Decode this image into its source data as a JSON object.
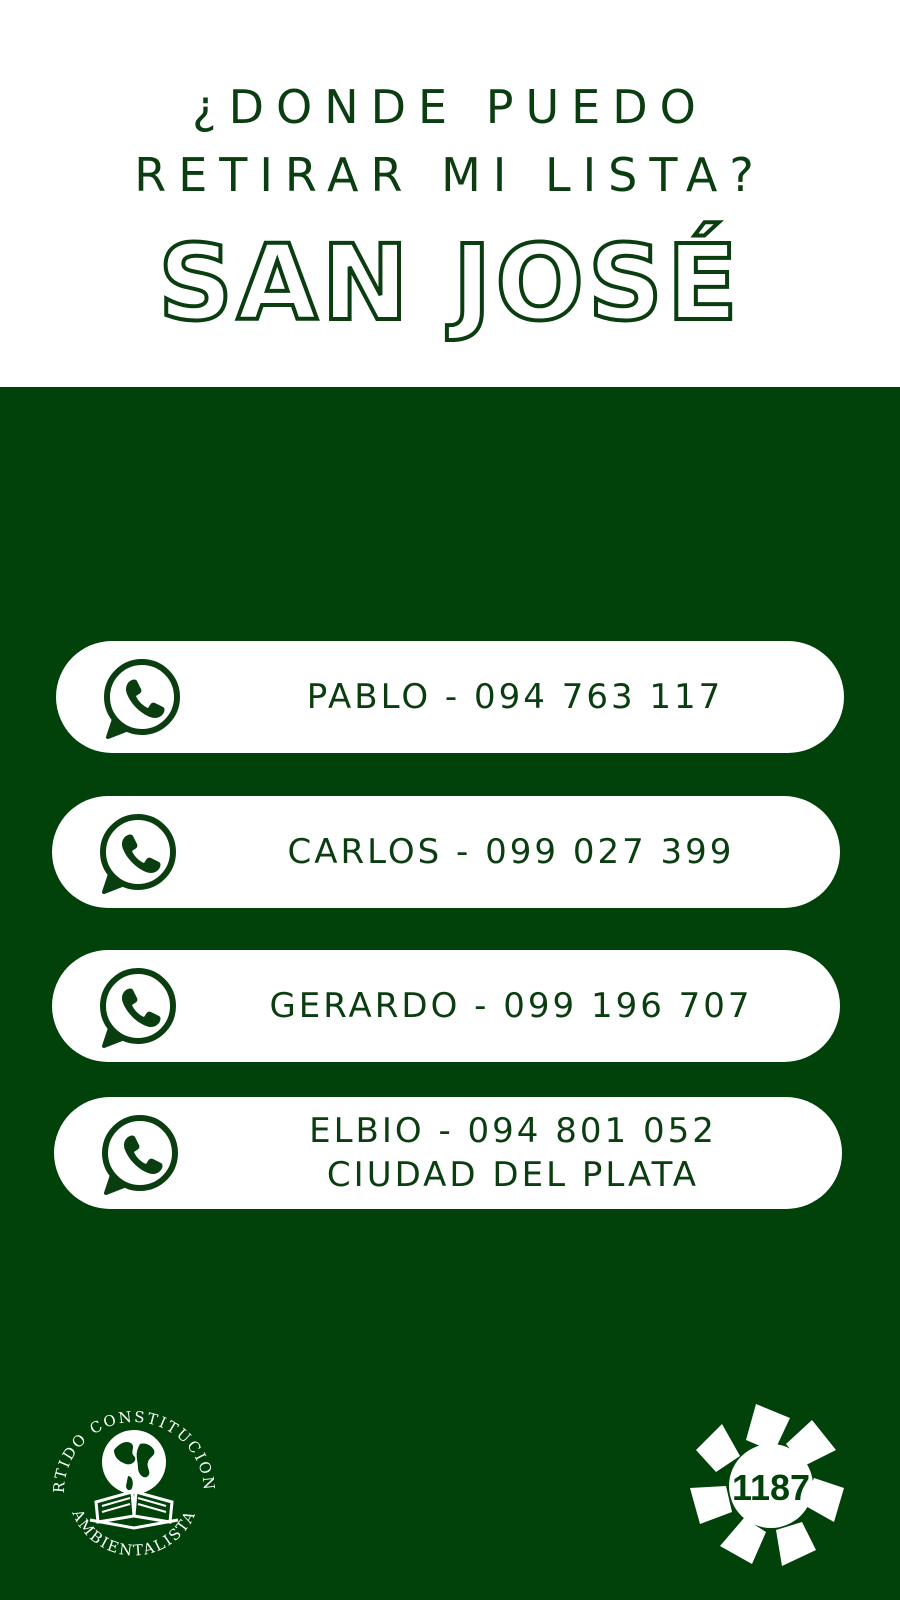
{
  "header": {
    "question_line1": "¿DONDE PUEDO",
    "question_line2": "RETIRAR MI LISTA?",
    "city": "SAN JOSÉ"
  },
  "contacts": [
    {
      "line1": "PABLO - 094 763 117",
      "line2": "",
      "icon": "whatsapp-icon"
    },
    {
      "line1": "CARLOS - 099 027 399",
      "line2": "",
      "icon": "whatsapp-icon"
    },
    {
      "line1": "GERARDO - 099 196 707",
      "line2": "",
      "icon": "whatsapp-icon"
    },
    {
      "line1": "ELBIO - 094 801 052",
      "line2": "CIUDAD DEL PLATA",
      "icon": "whatsapp-icon"
    }
  ],
  "footer": {
    "seal_text_top": "PARTIDO CONSTITUCIONAL",
    "seal_text_bottom": "AMBIENTALISTA",
    "list_number": "1187"
  },
  "colors": {
    "brand_green": "#004209",
    "text_green": "#0a3d0f",
    "white": "#ffffff"
  }
}
